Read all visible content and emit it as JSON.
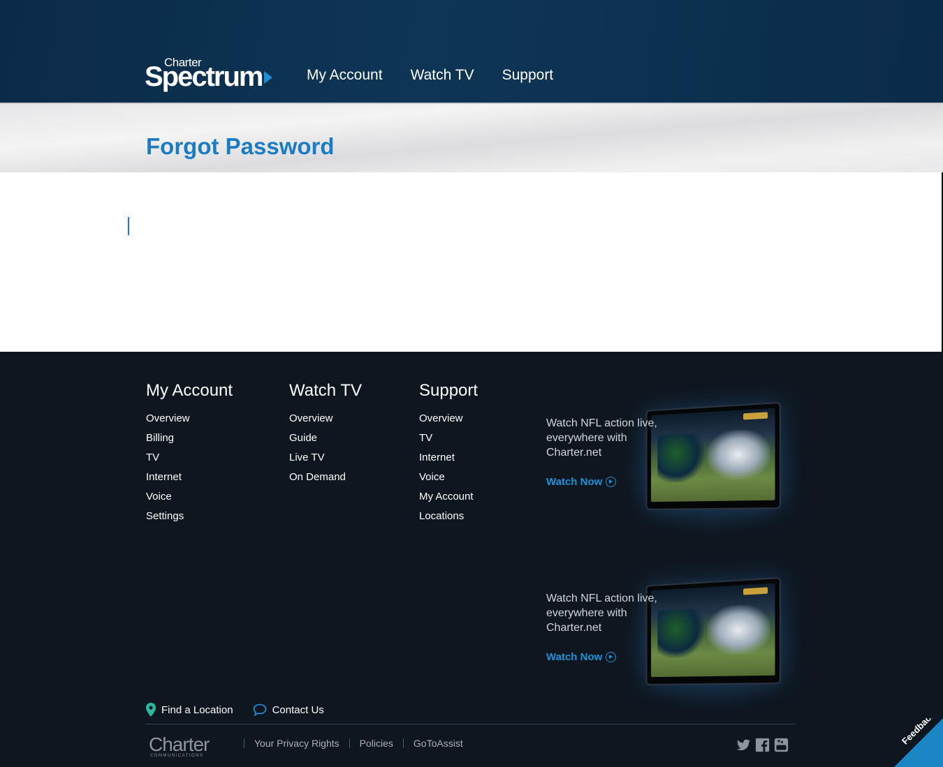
{
  "header": {
    "logo_top": "Charter",
    "logo_main": "Spectrum",
    "nav": [
      {
        "label": "My Account"
      },
      {
        "label": "Watch TV"
      },
      {
        "label": "Support"
      }
    ]
  },
  "banner": {
    "title": "Forgot Password"
  },
  "footer": {
    "columns": [
      {
        "heading": "My Account",
        "links": [
          "Overview",
          "Billing",
          "TV",
          "Internet",
          "Voice",
          "Settings"
        ]
      },
      {
        "heading": "Watch TV",
        "links": [
          "Overview",
          "Guide",
          "Live TV",
          "On Demand"
        ]
      },
      {
        "heading": "Support",
        "links": [
          "Overview",
          "TV",
          "Internet",
          "Voice",
          "My Account",
          "Locations"
        ]
      }
    ],
    "promos": [
      {
        "text": "Watch NFL action live, everywhere with Charter.net",
        "cta": "Watch Now"
      },
      {
        "text": "Watch NFL action live, everywhere with Charter.net",
        "cta": "Watch Now"
      }
    ],
    "utility_links": {
      "find_location": "Find a Location",
      "contact_us": "Contact Us"
    },
    "charter_logo": {
      "word": "Charter",
      "sub": "COMMUNICATIONS"
    },
    "legal_links": [
      "Your Privacy Rights",
      "Policies",
      "GoToAssist"
    ],
    "social_icons": [
      "twitter-icon",
      "facebook-icon",
      "youtube-icon"
    ]
  },
  "feedback_tab": {
    "label": "Feedback"
  },
  "colors": {
    "header_bg": "#0d3151",
    "accent_blue": "#1c7cc2",
    "footer_bg": "#0e1620",
    "cta_blue": "#1e93d9"
  }
}
